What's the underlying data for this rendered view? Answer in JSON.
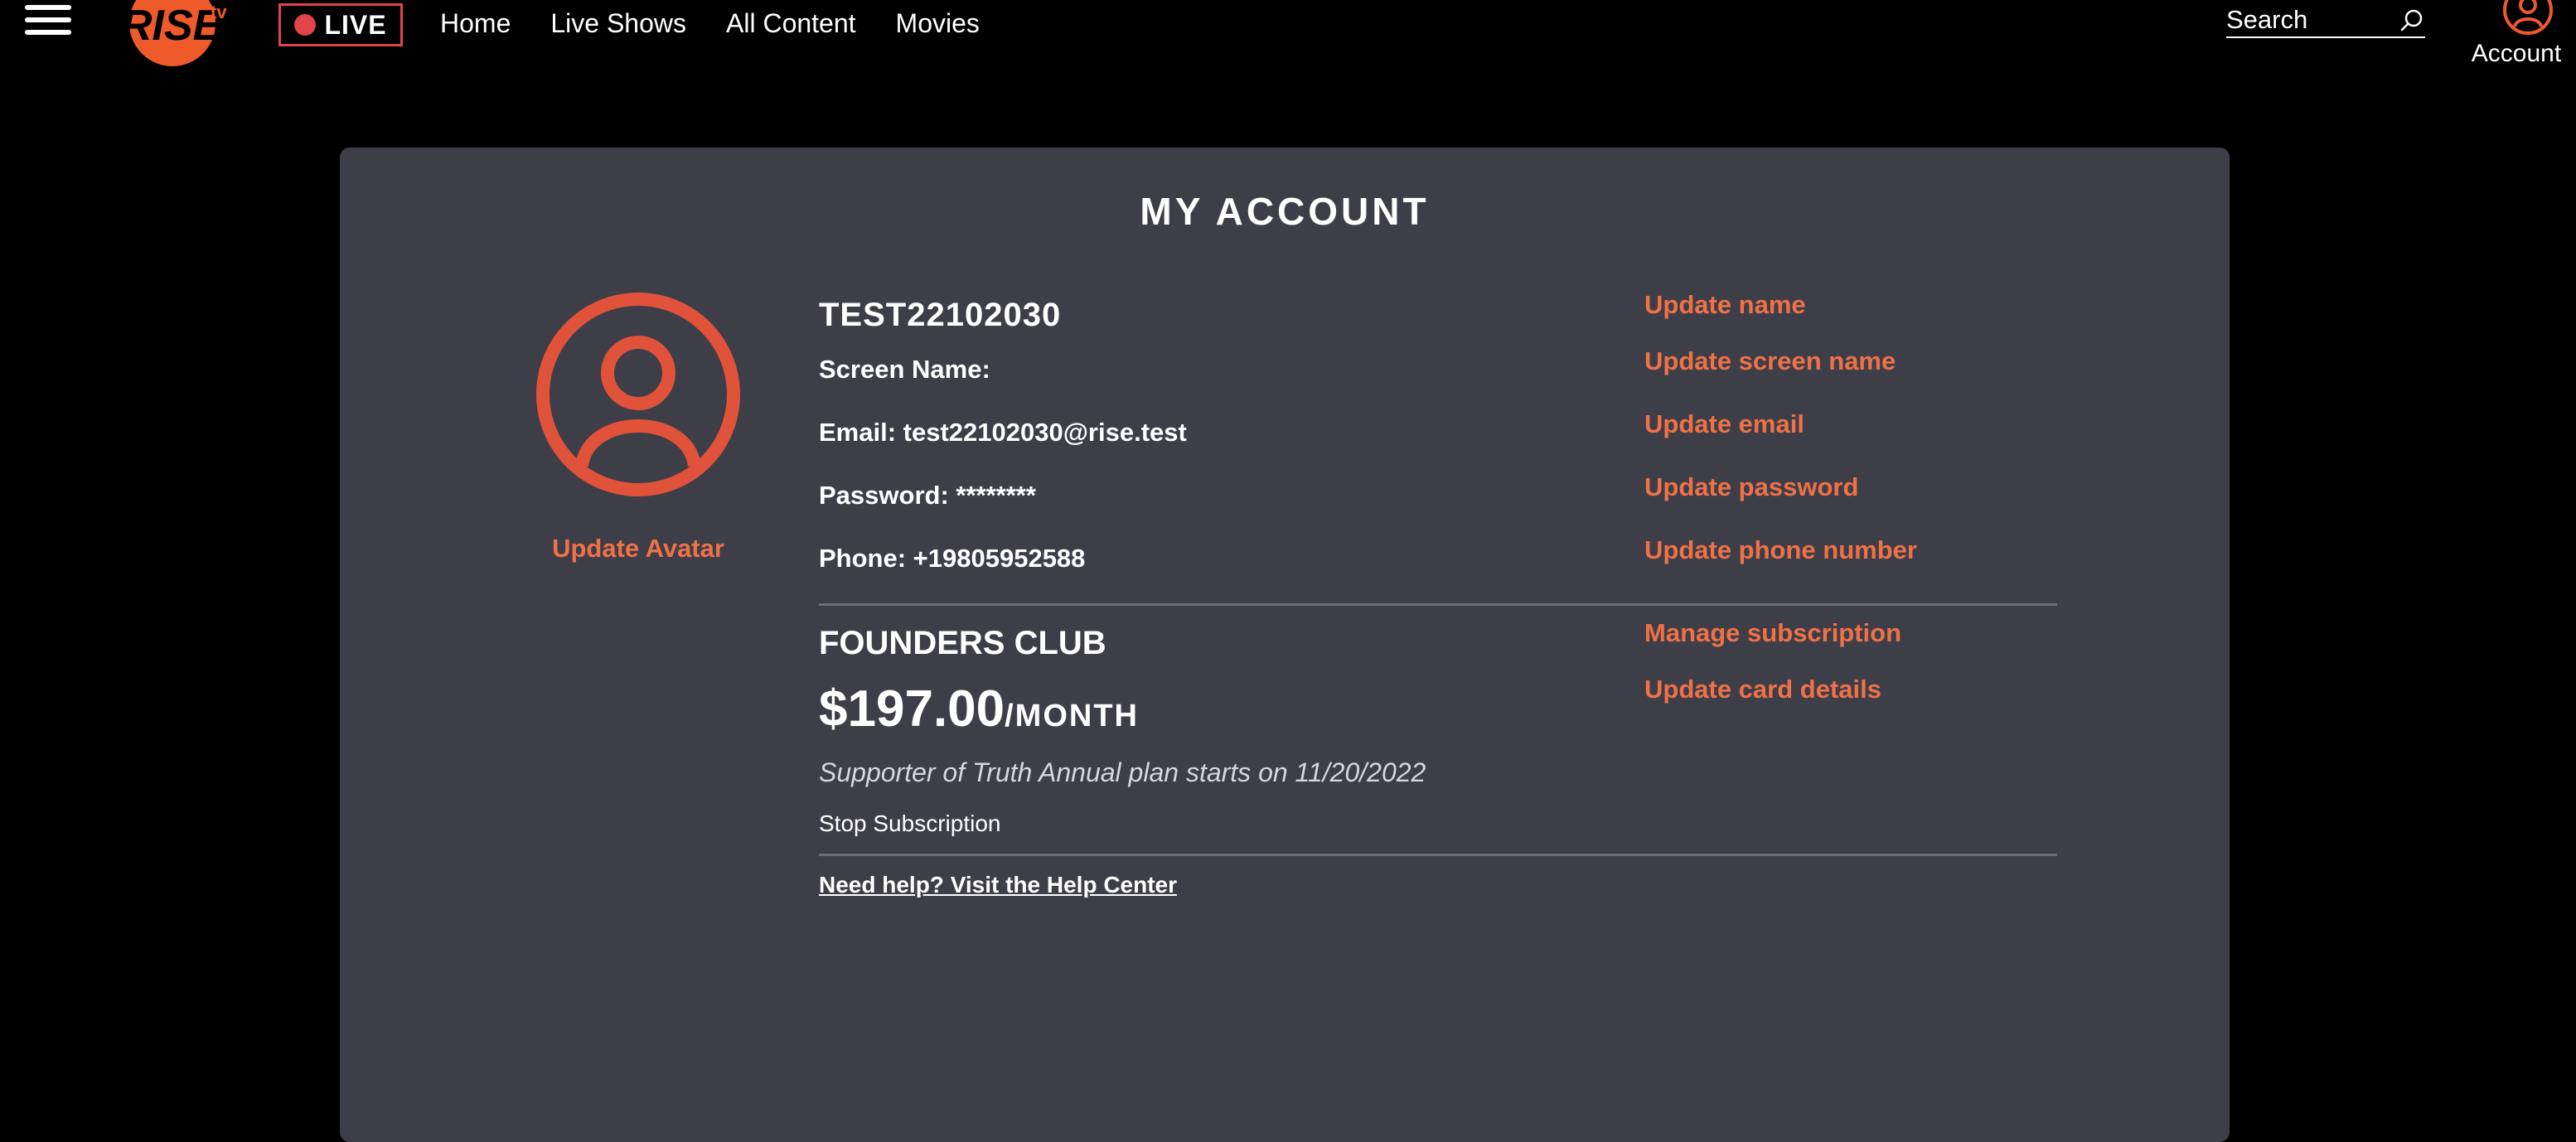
{
  "header": {
    "logo_text": "RISE",
    "live_label": "LIVE",
    "nav": [
      {
        "label": "Home"
      },
      {
        "label": "Live Shows"
      },
      {
        "label": "All Content"
      },
      {
        "label": "Movies"
      }
    ],
    "search_placeholder": "Search",
    "account_label": "Account"
  },
  "account": {
    "title": "MY ACCOUNT",
    "update_avatar": "Update Avatar",
    "username": "TEST22102030",
    "screen_name": "Screen Name:",
    "email": "Email: test22102030@rise.test",
    "password": "Password: ********",
    "phone": "Phone: +19805952588",
    "actions": {
      "update_name": "Update name",
      "update_screen_name": "Update screen name",
      "update_email": "Update email",
      "update_password": "Update password",
      "update_phone": "Update phone number",
      "manage_subscription": "Manage subscription",
      "update_card": "Update card details"
    },
    "plan": {
      "name": "FOUNDERS CLUB",
      "price": "$197.00",
      "period": "/MONTH",
      "note": "Supporter of Truth Annual plan starts on 11/20/2022",
      "stop": "Stop Subscription"
    },
    "help_link": "Need help? Visit the Help Center"
  },
  "colors": {
    "accent": "#ee7147",
    "live": "#e0434a",
    "card_bg": "#3e3e48",
    "page_bg": "#000000"
  }
}
